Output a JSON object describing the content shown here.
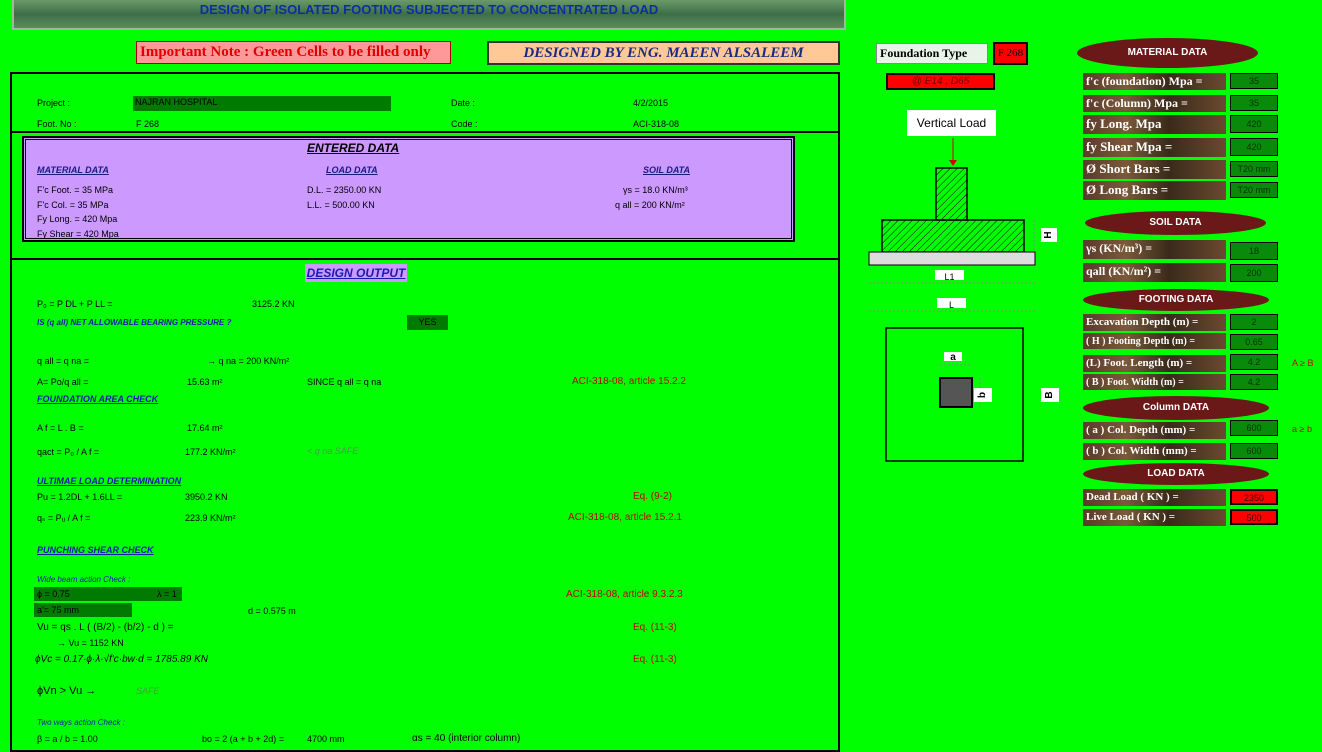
{
  "title": "DESIGN  OF  ISOLATED FOOTING SUBJECTED TO CONCENTRATED  LOAD",
  "note": "Important Note :  Green Cells to be filled only",
  "designed_by": "DESIGNED BY ENG. MAEEN ALSALEEM",
  "header": {
    "project_label": "Project      :",
    "project_value": "NAJRAN HOSPITAL",
    "date_label": "Date    :",
    "date_value": "4/2/2015",
    "foot_label": "Foot.   No :",
    "foot_value": "F 268",
    "code_label": "Code    :",
    "code_value": "ACI-318-08"
  },
  "entered": {
    "title": "ENTERED DATA",
    "material_head": "MATERIAL DATA",
    "load_head": "LOAD DATA",
    "soil_head": "SOIL DATA",
    "fc_foot": "F'c Foot. = 35  MPa",
    "fc_col": "F'c Col.   = 35 MPa",
    "fy_long": "Fy Long. = 420 Mpa",
    "fy_shear": "Fy Shear = 420 Mpa",
    "dl": "D.L. = 2350.00 KN",
    "ll": "L.L.  = 500.00 KN",
    "gs": "γs = 18.0 KN/m³",
    "qall": "q all = 200  KN/m²"
  },
  "output": {
    "title": "DESIGN OUTPUT",
    "po_eq": "P₀ = P DL + P LL =",
    "po_val": "3125.2  KN",
    "is_q": "IS  (q all) NET ALLOWABLE BEARING PRESSURE ?",
    "yes": "YES",
    "qall_eq": "q all = q na    =",
    "qna": "→ q na = 200  KN/m²",
    "a_eq": "A= Po/q all =",
    "a_val": "15.63 m²",
    "since": "SINCE  q all = q na",
    "ref1": "ACI-318-08, article 15.2.2",
    "found_check": "FOUNDATION AREA CHECK",
    "af_eq": "A f = L . B =",
    "af_val": "17.64 m²",
    "qact_eq": "qact = P₀ / A f =",
    "qact_val": "177.2  KN/m²",
    "safe1": "<  q na     SAFE",
    "ult": "ULTIMAE LOAD DETERMINATION",
    "pu_eq": "Pu = 1.2DL + 1.6LL =",
    "pu_val": "3950.2  KN",
    "eq92": "Eq. (9-2)",
    "qs_eq": "qₛ = Pᵤ / A f =",
    "qs_val": "223.9  KN/m²",
    "ref2": "ACI-318-08, article  15.2.1",
    "punch": "PUNCHING SHEAR CHECK",
    "wide": "Wide beam action Check :",
    "phi": "ϕ = 0.75",
    "lambda": "λ = 1",
    "ref3": "ACI-318-08, article  9.3.2.3",
    "a_cover": "a'=  75  mm",
    "d_val": "d = 0.575 m",
    "vu_eq": "Vu = qs . L ( (B/2) - (b/2) - d ) =",
    "eq113a": "Eq. (11-3)",
    "vu_val": "→ Vu = 1152  KN",
    "vc_eq": "ϕVc = 0.17·ϕ·λ·√f'c·bw·d = 1785.89 KN",
    "eq113b": "Eq. (11-3)",
    "vn_check": "ϕVn  >  Vu  →",
    "safe2": "SAFE",
    "two_ways": "Two ways action Check :",
    "beta": "β = a / b =   1.00",
    "bo": "bo = 2 (a + b + 2d) =",
    "bo_val": "4700 mm",
    "alpha": "αs  = 40  (interior column)"
  },
  "diagram": {
    "foundation_type_label": "Foundation Type",
    "foundation_type_value": "F 268",
    "grid_ref": "@ E14 , D65",
    "vertical_load": "Vertical Load",
    "h": "H",
    "l1": "L1",
    "l": "L",
    "a": "a",
    "b": "b",
    "bb": "B"
  },
  "panel": {
    "material_title": "MATERIAL DATA",
    "fc_found": "f'c (foundation) Mpa =",
    "fc_found_v": "35",
    "fc_col": "f'c  (Column)  Mpa =",
    "fc_col_v": "35",
    "fy_long": "fy  Long.      Mpa",
    "fy_long_v": "420",
    "fy_shear": "fy  Shear   Mpa   =",
    "fy_shear_v": "420",
    "short_bars": "Ø     Short Bars       =",
    "short_bars_v": "T20  mm",
    "long_bars": "Ø     Long  Bars       =",
    "long_bars_v": "T20  mm",
    "soil_title": "SOIL DATA",
    "gs": "γs      (KN/m³)      =",
    "gs_v": "18",
    "qall": "qall    (KN/m²)      =",
    "qall_v": "200",
    "footing_title": "FOOTING DATA",
    "exc": "Excavation Depth (m) =",
    "exc_v": "2",
    "hd": "( H ) Footing Depth (m) =",
    "hd_v": "0.65",
    "fl": "(L)  Foot. Length (m) =",
    "fl_v": "4.2",
    "fw": "( B )  Foot. Width   (m) =",
    "fw_v": "4.2",
    "a_ge_b1": "A ≥ B",
    "column_title": "Column DATA",
    "cd": "( a )  Col. Depth  (mm) =",
    "cd_v": "600",
    "cw": "( b ) Col. Width (mm) =",
    "cw_v": "600",
    "a_ge_b2": "a ≥ b",
    "load_title": "LOAD DATA",
    "dead": "Dead Load      ( KN ) =",
    "dead_v": "2350",
    "live": "Live Load      ( KN ) =",
    "live_v": "500"
  },
  "colors": {
    "background": "#00ff00",
    "input_red": "#ff0000",
    "panel_oval": "#6b1818"
  }
}
